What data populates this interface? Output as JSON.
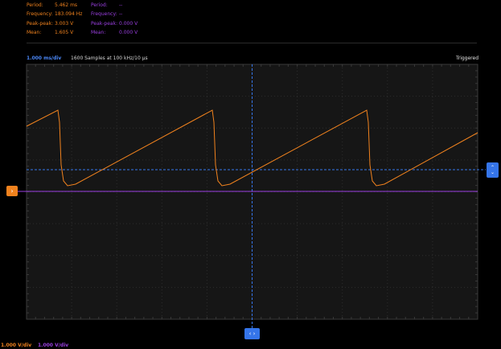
{
  "measurements": {
    "ch1": {
      "color": "#f0821e",
      "rows": [
        {
          "label": "Period:",
          "value": "5.462 ms"
        },
        {
          "label": "Frequency:",
          "value": "183.094 Hz"
        },
        {
          "label": "Peak-peak:",
          "value": "3.003 V"
        },
        {
          "label": "Mean:",
          "value": "1.605 V"
        }
      ]
    },
    "ch2": {
      "color": "#9a3fe0",
      "rows": [
        {
          "label": "Period:",
          "value": "--"
        },
        {
          "label": "Frequency:",
          "value": "--"
        },
        {
          "label": "Peak-peak:",
          "value": "0.000 V"
        },
        {
          "label": "Mean:",
          "value": "0.000 V"
        }
      ]
    }
  },
  "status": {
    "timebase": "1.000 ms/div",
    "samples": "1600 Samples at 100 kHz/10 µs",
    "trigger_state": "Triggered"
  },
  "markers": {
    "ch1_level": "›",
    "trigger_up": "⌃",
    "trigger_down": "⌄",
    "trigger_position": "‹ ›"
  },
  "scales": {
    "ch1": "1.000 V/div",
    "ch2": "1.000 V/div"
  },
  "chart_data": {
    "type": "line",
    "x_divisions": 10,
    "y_divisions": 8,
    "grid": true,
    "series": [
      {
        "name": "CH1",
        "color": "#f0821e",
        "shape": "ramp with sharp drop",
        "period_ms": 5.462,
        "peak_peak_v": 3.003,
        "mean_v": 1.605
      },
      {
        "name": "CH2",
        "color": "#9a3fe0",
        "shape": "flat",
        "mean_v": 0.0
      }
    ],
    "trigger_color": "#3575ea"
  }
}
